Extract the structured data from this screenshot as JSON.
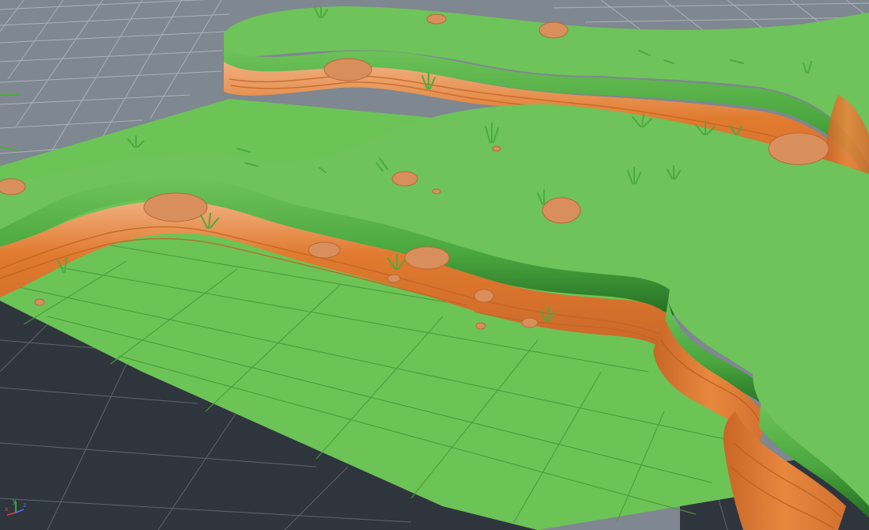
{
  "colors": {
    "viewport_bg": "#7f8790",
    "grid_line": "#b6bcc4",
    "ground_dark": "#2f353d",
    "ground_dark_grid": "#5d646d",
    "floor_green": "#6cc456",
    "floor_grid": "#4a9a3c",
    "grass_top": "#6ec35a",
    "grass_shadow": "#2f8a2a",
    "cliff_orange": "#e07a2e",
    "cliff_light": "#e9a270",
    "cliff_dark": "#b85e22",
    "rock": "#d98f5c",
    "tuft": "#4cab3e",
    "axis_x": "#e04040",
    "axis_y": "#40c040",
    "axis_z": "#4070ff"
  },
  "icons": {
    "axis_gizmo": "axis-gizmo-icon"
  },
  "axis_labels": {
    "x": "x",
    "y": "y",
    "z": "z"
  }
}
